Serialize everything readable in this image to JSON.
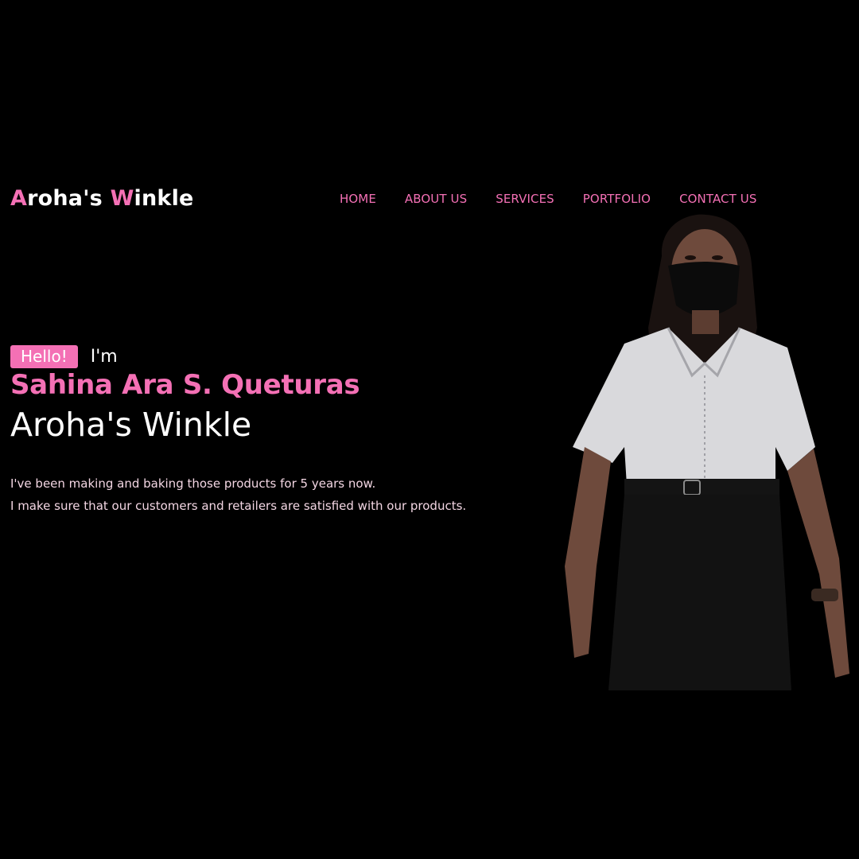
{
  "header": {
    "logo_first_initial": "A",
    "logo_first_rest": "roha's ",
    "logo_second_initial": "W",
    "logo_second_rest": "inkle",
    "nav": [
      "HOME",
      "ABOUT US",
      "SERVICES",
      "PORTFOLIO",
      "CONTACT US"
    ]
  },
  "hero": {
    "hello_badge": "Hello!",
    "intro": "I'm",
    "name": "Sahina Ara S. Queturas",
    "brand": "Aroha's Winkle",
    "description": [
      "I've been making and baking those products for 5 years now.",
      "I make sure that our customers and retailers are satisfied with our products."
    ]
  },
  "colors": {
    "background": "#000000",
    "accent": "#f470b5",
    "text": "#ffffff"
  }
}
